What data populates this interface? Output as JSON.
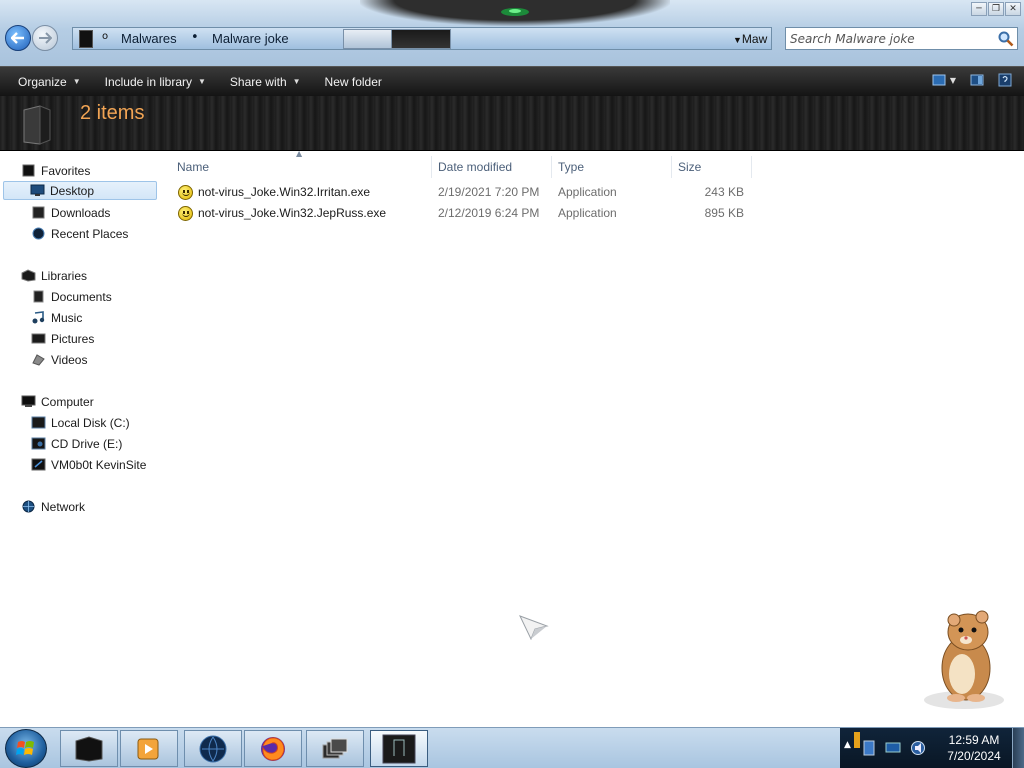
{
  "address": {
    "crumbs": [
      "Malwares",
      "Malware joke"
    ],
    "dropdown_text": "Maw",
    "search_placeholder": "Search Malware joke"
  },
  "window_buttons": {
    "minimize": "─",
    "maximize": "❐",
    "close": "✕"
  },
  "toolbar": {
    "organize": "Organize",
    "include_in_library": "Include in library",
    "share_with": "Share with",
    "new_folder": "New folder"
  },
  "details": {
    "item_count": "2 items"
  },
  "nav": {
    "favorites": "Favorites",
    "desktop": "Desktop",
    "downloads": "Downloads",
    "recent_places": "Recent Places",
    "libraries": "Libraries",
    "documents": "Documents",
    "music": "Music",
    "pictures": "Pictures",
    "videos": "Videos",
    "computer": "Computer",
    "local_disk": "Local Disk (C:)",
    "cd_drive": "CD Drive (E:)",
    "vm_share": "VM0b0t KevinSite",
    "network": "Network"
  },
  "columns": {
    "name": "Name",
    "date_modified": "Date modified",
    "type": "Type",
    "size": "Size"
  },
  "files": [
    {
      "name": "not-virus_Joke.Win32.Irritan.exe",
      "date": "2/19/2021 7:20 PM",
      "type": "Application",
      "size": "243 KB"
    },
    {
      "name": "not-virus_Joke.Win32.JepRuss.exe",
      "date": "2/12/2019 6:24 PM",
      "type": "Application",
      "size": "895 KB"
    }
  ],
  "clock": {
    "time": "12:59 AM",
    "date": "7/20/2024"
  },
  "colors": {
    "item_count": "#f1a454",
    "toolbar_bg": "#1f1f1f",
    "taskbar_bg": "#b8d0e8"
  }
}
